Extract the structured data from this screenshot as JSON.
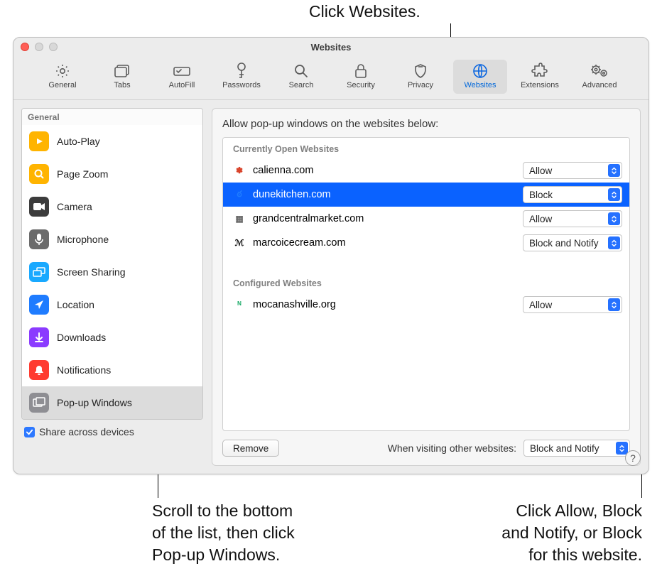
{
  "callouts": {
    "top": "Click Websites.",
    "bottomLeft1": "Scroll to the bottom",
    "bottomLeft2": "of the list, then click",
    "bottomLeft3": "Pop-up Windows.",
    "bottomRight1": "Click Allow, Block",
    "bottomRight2": "and Notify, or Block",
    "bottomRight3": "for this website."
  },
  "window": {
    "title": "Websites",
    "toolbar": [
      {
        "label": "General",
        "active": false
      },
      {
        "label": "Tabs",
        "active": false
      },
      {
        "label": "AutoFill",
        "active": false
      },
      {
        "label": "Passwords",
        "active": false
      },
      {
        "label": "Search",
        "active": false
      },
      {
        "label": "Security",
        "active": false
      },
      {
        "label": "Privacy",
        "active": false
      },
      {
        "label": "Websites",
        "active": true
      },
      {
        "label": "Extensions",
        "active": false
      },
      {
        "label": "Advanced",
        "active": false
      }
    ]
  },
  "sidebar": {
    "header": "General",
    "items": [
      {
        "label": "Auto-Play",
        "color": "#ffb400"
      },
      {
        "label": "Page Zoom",
        "color": "#ffb400"
      },
      {
        "label": "Camera",
        "color": "#3c3c3c"
      },
      {
        "label": "Microphone",
        "color": "#6b6b6b"
      },
      {
        "label": "Screen Sharing",
        "color": "#19a9ff"
      },
      {
        "label": "Location",
        "color": "#1f7cff"
      },
      {
        "label": "Downloads",
        "color": "#8b3bff"
      },
      {
        "label": "Notifications",
        "color": "#ff3b30"
      },
      {
        "label": "Pop-up Windows",
        "color": "#8e8e93",
        "active": true
      }
    ]
  },
  "panel": {
    "title": "Allow pop-up windows on the websites below:",
    "openHeader": "Currently Open Websites",
    "configHeader": "Configured Websites",
    "open": [
      {
        "domain": "calienna.com",
        "value": "Allow",
        "selected": false
      },
      {
        "domain": "dunekitchen.com",
        "value": "Block",
        "selected": true
      },
      {
        "domain": "grandcentralmarket.com",
        "value": "Allow",
        "selected": false
      },
      {
        "domain": "marcoicecream.com",
        "value": "Block and Notify",
        "selected": false
      }
    ],
    "configured": [
      {
        "domain": "mocanashville.org",
        "value": "Allow"
      }
    ],
    "remove": "Remove",
    "otherLabel": "When visiting other websites:",
    "otherValue": "Block and Notify",
    "share": "Share across devices"
  }
}
